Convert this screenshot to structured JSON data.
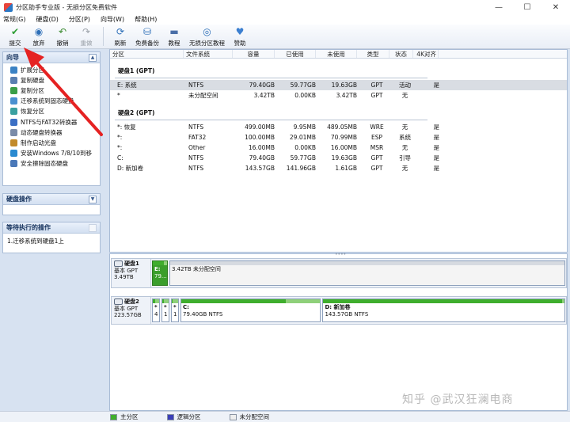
{
  "window": {
    "title": "分区助手专业版 - 无损分区免费软件",
    "controls": [
      "—",
      "☐",
      "✕"
    ]
  },
  "menu": [
    "常规(G)",
    "硬盘(D)",
    "分区(P)",
    "向导(W)",
    "帮助(H)"
  ],
  "toolbar": [
    {
      "label": "提交",
      "icon": "✔",
      "color": "#2e9e35",
      "disabled": false
    },
    {
      "label": "放弃",
      "icon": "◉",
      "color": "#2d6fb8",
      "disabled": false
    },
    {
      "label": "撤销",
      "icon": "↶",
      "color": "#3a8a2e",
      "disabled": false
    },
    {
      "label": "重做",
      "icon": "↷",
      "color": "#9aa0a8",
      "disabled": true
    },
    {
      "label": "刷新",
      "icon": "⟳",
      "color": "#2d6fb8",
      "disabled": false
    },
    {
      "label": "免费备份",
      "icon": "⛁",
      "color": "#2d6fb8",
      "disabled": false
    },
    {
      "label": "教程",
      "icon": "▬",
      "color": "#4a6fa8",
      "disabled": false
    },
    {
      "label": "无损分区教程",
      "icon": "◎",
      "color": "#2d6fb8",
      "disabled": false
    },
    {
      "label": "赞助",
      "icon": "♥",
      "color": "#3b7fd0",
      "disabled": false
    }
  ],
  "left_panel": {
    "wizard_title": "向导",
    "wizard_items": [
      {
        "label": "扩展分区",
        "icon": "expand-icon",
        "color": "#3b82c4"
      },
      {
        "label": "复制硬盘",
        "icon": "copy-disk-icon",
        "color": "#5a7fb0"
      },
      {
        "label": "复制分区",
        "icon": "copy-partition-icon",
        "color": "#3a9e47"
      },
      {
        "label": "迁移系统到固态硬盘",
        "icon": "migrate-icon",
        "color": "#4a90d0"
      },
      {
        "label": "恢复分区",
        "icon": "recover-icon",
        "color": "#3aa0a0"
      },
      {
        "label": "NTFS与FAT32转换器",
        "icon": "convert-icon",
        "color": "#3b6fc4"
      },
      {
        "label": "动态硬盘转换器",
        "icon": "dynamic-disk-icon",
        "color": "#7a8ba8"
      },
      {
        "label": "制作启动光盘",
        "icon": "boot-disc-icon",
        "color": "#c28a2a"
      },
      {
        "label": "安装Windows 7/8/10到移",
        "icon": "windows-icon",
        "color": "#2a8ad0"
      },
      {
        "label": "安全擦除固态硬盘",
        "icon": "erase-icon",
        "color": "#4a78b8"
      }
    ],
    "disk_ops_title": "硬盘操作",
    "pending_title": "等待执行的操作",
    "pending_items": [
      "1.迁移系统到硬盘1上"
    ]
  },
  "partition_table": {
    "columns": [
      "分区",
      "文件系统",
      "容量",
      "已使用",
      "未使用",
      "类型",
      "状态",
      "4K对齐"
    ],
    "disks": [
      {
        "label": "硬盘1 (GPT)",
        "rows": [
          {
            "partition": "E: 系统",
            "fs": "NTFS",
            "capacity": "79.40GB",
            "used": "59.77GB",
            "free": "19.63GB",
            "type": "GPT",
            "status": "活动",
            "align": "是",
            "selected": true
          },
          {
            "partition": "*",
            "fs": "未分配空间",
            "capacity": "3.42TB",
            "used": "0.00KB",
            "free": "3.42TB",
            "type": "GPT",
            "status": "无",
            "align": "",
            "selected": false
          }
        ]
      },
      {
        "label": "硬盘2 (GPT)",
        "rows": [
          {
            "partition": "*: 恢复",
            "fs": "NTFS",
            "capacity": "499.00MB",
            "used": "9.95MB",
            "free": "489.05MB",
            "type": "WRE",
            "status": "无",
            "align": "是",
            "selected": false
          },
          {
            "partition": "*:",
            "fs": "FAT32",
            "capacity": "100.00MB",
            "used": "29.01MB",
            "free": "70.99MB",
            "type": "ESP",
            "status": "系统",
            "align": "是",
            "selected": false
          },
          {
            "partition": "*:",
            "fs": "Other",
            "capacity": "16.00MB",
            "used": "0.00KB",
            "free": "16.00MB",
            "type": "MSR",
            "status": "无",
            "align": "是",
            "selected": false
          },
          {
            "partition": "C:",
            "fs": "NTFS",
            "capacity": "79.40GB",
            "used": "59.77GB",
            "free": "19.63GB",
            "type": "GPT",
            "status": "引导",
            "align": "是",
            "selected": false
          },
          {
            "partition": "D: 新加卷",
            "fs": "NTFS",
            "capacity": "143.57GB",
            "used": "141.96GB",
            "free": "1.61GB",
            "type": "GPT",
            "status": "无",
            "align": "是",
            "selected": false
          }
        ]
      }
    ]
  },
  "disk_map": [
    {
      "name": "硬盘1",
      "scheme": "基本 GPT",
      "size": "3.49TB",
      "segments": [
        {
          "line1": "E:",
          "line2": "79...",
          "used_fraction": 0.75,
          "kind": "selected",
          "flex": 0
        },
        {
          "line1": "",
          "line2": "3.42TB 未分配空间",
          "used_fraction": 0,
          "kind": "unalloc",
          "flex": 1
        }
      ]
    },
    {
      "name": "硬盘2",
      "scheme": "基本 GPT",
      "size": "223.57GB",
      "segments": [
        {
          "line1": "*",
          "line2": "4",
          "used_fraction": 0.4,
          "kind": "small",
          "flex": 0
        },
        {
          "line1": "*",
          "line2": "1",
          "used_fraction": 0.3,
          "kind": "small",
          "flex": 0
        },
        {
          "line1": "*",
          "line2": "1",
          "used_fraction": 0.1,
          "kind": "small",
          "flex": 0
        },
        {
          "line1": "C:",
          "line2": "79.40GB NTFS",
          "used_fraction": 0.75,
          "kind": "primary",
          "flex": 174
        },
        {
          "line1": "D: 新加卷",
          "line2": "143.57GB NTFS",
          "used_fraction": 0.99,
          "kind": "primary",
          "flex": 305
        }
      ]
    }
  ],
  "legend": [
    {
      "label": "主分区",
      "color": "#3fae2d"
    },
    {
      "label": "逻辑分区",
      "color": "#3b3fb8"
    },
    {
      "label": "未分配空间",
      "color": "#eeeeee"
    }
  ],
  "watermark": "知乎 @武汉狂澜电商"
}
